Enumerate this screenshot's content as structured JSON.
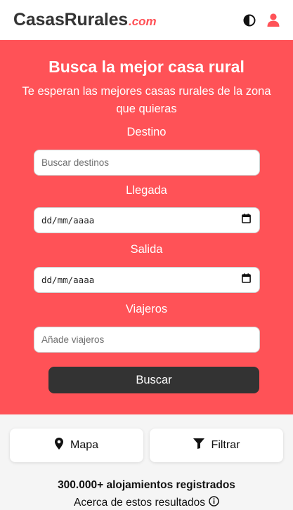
{
  "header": {
    "logo_main": "CasasRurales",
    "logo_domain": ".com",
    "icons": [
      "contrast-icon",
      "user-icon"
    ],
    "accent_color": "#ff5257"
  },
  "hero": {
    "title": "Busca la mejor casa rural",
    "subtitle": "Te esperan las mejores casas rurales de la zona que quieras",
    "background_color": "#ff5257",
    "destination": {
      "label": "Destino",
      "placeholder": "Buscar destinos",
      "value": ""
    },
    "arrival": {
      "label": "Llegada",
      "value": "dd/mm/aaaa"
    },
    "departure": {
      "label": "Salida",
      "value": "dd/mm/aaaa"
    },
    "travelers": {
      "label": "Viajeros",
      "placeholder": "Añade viajeros",
      "value": ""
    },
    "search_label": "Buscar"
  },
  "actions": {
    "map_label": "Mapa",
    "filter_label": "Filtrar"
  },
  "results": {
    "count_text": "300.000+ alojamientos registrados",
    "about_text": "Acerca de estos resultados"
  }
}
